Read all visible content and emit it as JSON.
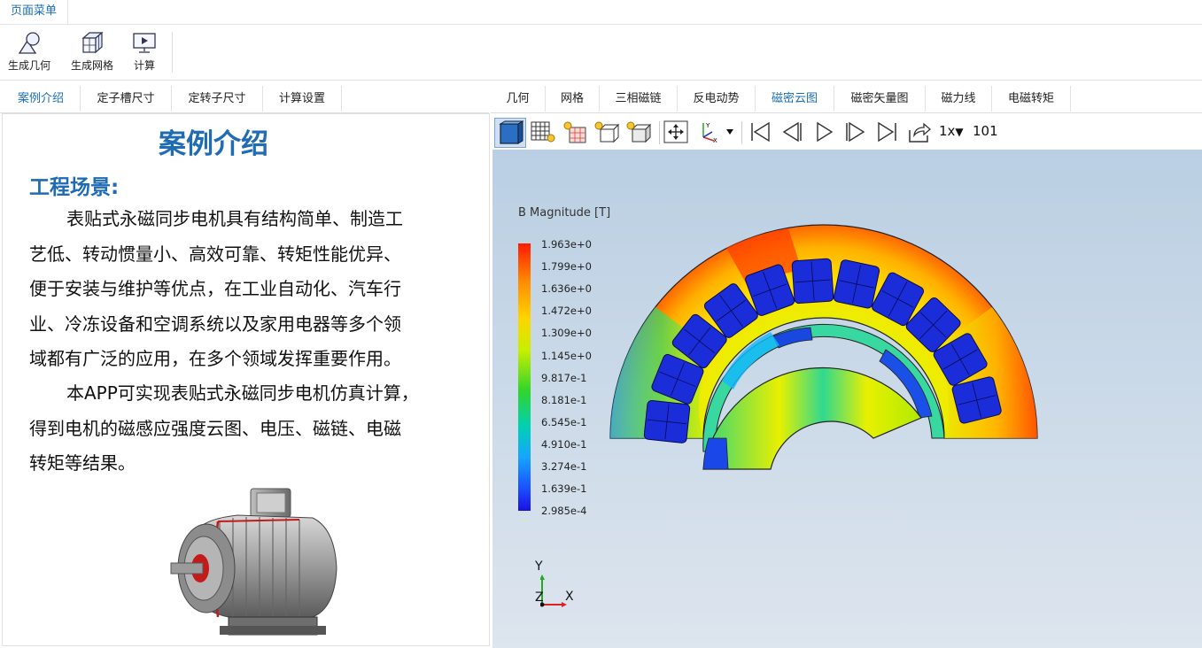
{
  "menu": {
    "tab": "页面菜单"
  },
  "ribbon": {
    "buttons": [
      {
        "label": "生成几何",
        "icon": "geometry-icon"
      },
      {
        "label": "生成网格",
        "icon": "mesh-icon"
      },
      {
        "label": "计算",
        "icon": "compute-icon"
      }
    ]
  },
  "left_tabs": [
    "案例介绍",
    "定子槽尺寸",
    "定转子尺寸",
    "计算设置"
  ],
  "left_active": "案例介绍",
  "doc": {
    "title": "案例介绍",
    "heading": "工程场景:",
    "para1_lines": [
      "表贴式永磁同步电机具有结构简单、制造工",
      "艺低、转动惯量小、高效可靠、转矩性能优异、",
      "便于安装与维护等优点，在工业自动化、汽车行",
      "业、冷冻设备和空调系统以及家用电器等多个领",
      "域都有广泛的应用，在多个领域发挥重要作用。"
    ],
    "para2_lines": [
      "本APP可实现表贴式永磁同步电机仿真计算，",
      "得到电机的磁感应强度云图、电压、磁链、电磁",
      "转矩等结果。"
    ]
  },
  "right_tabs": [
    "几何",
    "网格",
    "三相磁链",
    "反电动势",
    "磁密云图",
    "磁密矢量图",
    "磁力线",
    "电磁转矩"
  ],
  "right_active": "磁密云图",
  "toolbar": {
    "icons": [
      "solid-view-icon",
      "mesh-view-icon",
      "mesh-light-icon",
      "wireframe-light-icon",
      "surface-light-icon",
      "fit-view-icon",
      "axis-orient-icon",
      "first-frame-icon",
      "prev-frame-icon",
      "play-icon",
      "next-frame-icon",
      "last-frame-icon",
      "export-icon"
    ],
    "speed": "1x",
    "frame": "101"
  },
  "colorbar": {
    "title": "B Magnitude [T]",
    "labels": [
      "1.963e+0",
      "1.799e+0",
      "1.636e+0",
      "1.472e+0",
      "1.309e+0",
      "1.145e+0",
      "9.817e-1",
      "8.181e-1",
      "6.545e-1",
      "4.910e-1",
      "3.274e-1",
      "1.639e-1",
      "2.985e-4"
    ],
    "max_color": "#ff1a00",
    "min_color": "#1a10e0"
  },
  "axes": {
    "y": "Y",
    "z": "Z",
    "x": "X"
  },
  "colors": {
    "accent": "#1a6fb5",
    "title_blue": "#1f6bb4"
  }
}
